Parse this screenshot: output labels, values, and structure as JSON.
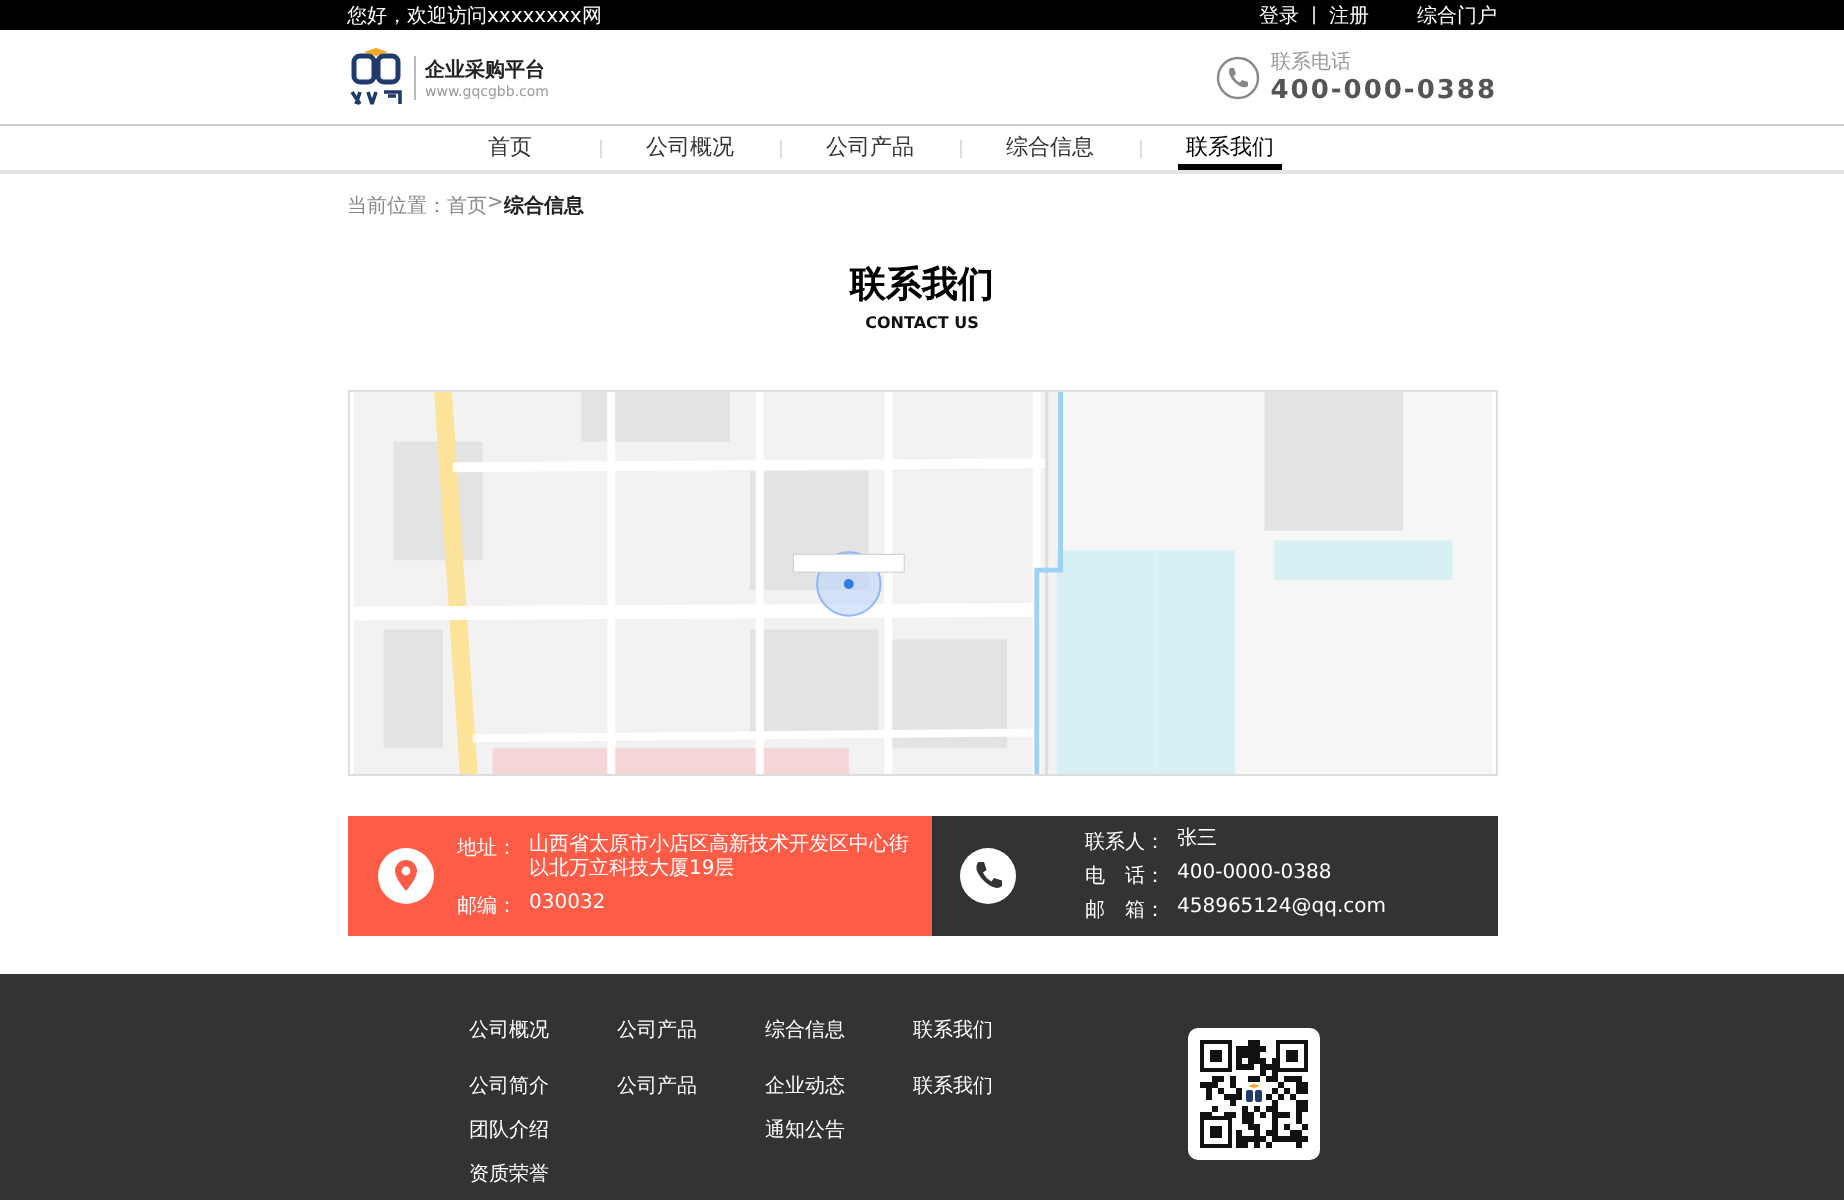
{
  "top_bar": {
    "greeting": "您好，欢迎访问xxxxxxxx网",
    "links": [
      "登录",
      "注册"
    ],
    "separator": "|",
    "portal": "综合门户"
  },
  "header": {
    "platform": "企业采购平台",
    "url": "www.gqcgbb.com",
    "phone_label": "联系电话",
    "phone": "400-000-0388"
  },
  "nav": [
    {
      "label": "首页",
      "selected": false
    },
    {
      "label": "公司概况",
      "selected": false
    },
    {
      "label": "公司产品",
      "selected": false
    },
    {
      "label": "综合信息",
      "selected": false
    },
    {
      "label": "联系我们",
      "selected": true
    }
  ],
  "breadcrumb": {
    "label": "当前位置：",
    "home": "首页",
    "separator": ">",
    "current": "综合信息"
  },
  "heading": {
    "title": "联系我们",
    "subtitle": "CONTACT US"
  },
  "contact": {
    "address": [
      {
        "label": "地址：",
        "value": "山西省太原市小店区高新技术开发区中心街以北万立科技大厦19层"
      },
      {
        "label": "邮编：",
        "value": "030032"
      }
    ],
    "people": [
      {
        "label": "联系人：",
        "value": "张三"
      },
      {
        "label": "电　话：",
        "value": "400-0000-0388"
      },
      {
        "label": "邮　箱：",
        "value": "458965124@qq.com"
      }
    ]
  },
  "footer": {
    "columns": [
      {
        "title": "公司概况",
        "links": [
          "公司简介",
          "团队介绍",
          "资质荣誉"
        ]
      },
      {
        "title": "公司产品",
        "links": [
          "公司产品"
        ]
      },
      {
        "title": "综合信息",
        "links": [
          "企业动态",
          "通知公告"
        ]
      },
      {
        "title": "联系我们",
        "links": [
          "联系我们"
        ]
      }
    ]
  }
}
